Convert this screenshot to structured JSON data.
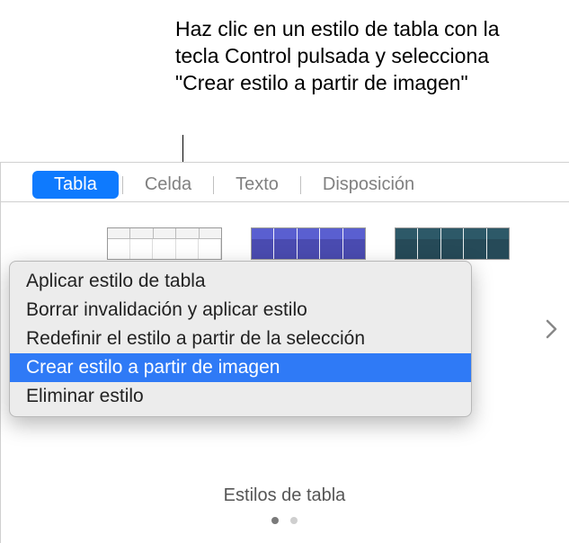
{
  "callout": {
    "text": "Haz clic en un estilo de tabla con la tecla Control pulsada y selecciona \"Crear estilo a partir de imagen\""
  },
  "tabs": {
    "tabla": "Tabla",
    "celda": "Celda",
    "texto": "Texto",
    "disposicion": "Disposición"
  },
  "context_menu": {
    "apply": "Aplicar estilo de tabla",
    "clear": "Borrar invalidación y aplicar estilo",
    "redefine": "Redefinir el estilo a partir de la selección",
    "create": "Crear estilo a partir de imagen",
    "delete": "Eliminar estilo"
  },
  "section_label": "Estilos de tabla"
}
